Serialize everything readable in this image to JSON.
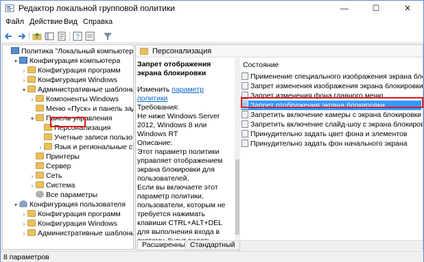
{
  "window": {
    "title": "Редактор локальной групповой политики",
    "accent": "#5a8ccc"
  },
  "menu": [
    "Файл",
    "Действие",
    "Вид",
    "Справка"
  ],
  "toolbar": {
    "icons": [
      "back-icon",
      "forward-icon",
      "up-folder-icon",
      "show-hide-tree-icon",
      "export-list-icon",
      "help-icon",
      "properties-icon",
      "filter-icon"
    ]
  },
  "tree": [
    {
      "label": "Политика \"Локальный компьютер\"",
      "depth": 0,
      "expand": "",
      "icon": "computer"
    },
    {
      "label": "Конфигурация компьютера",
      "depth": 1,
      "expand": "▾",
      "icon": "computer"
    },
    {
      "label": "Конфигурация программ",
      "depth": 2,
      "expand": "›",
      "icon": "folder"
    },
    {
      "label": "Конфигурация Windows",
      "depth": 2,
      "expand": "›",
      "icon": "folder"
    },
    {
      "label": "Административные шаблоны",
      "depth": 2,
      "expand": "▾",
      "icon": "folder"
    },
    {
      "label": "Компоненты Windows",
      "depth": 3,
      "expand": "›",
      "icon": "folder"
    },
    {
      "label": "Меню «Пуск» и панель задач",
      "depth": 3,
      "expand": "",
      "icon": "folder"
    },
    {
      "label": "Панель управления",
      "depth": 3,
      "expand": "▾",
      "icon": "folder"
    },
    {
      "label": "Персонализация",
      "depth": 4,
      "expand": "",
      "icon": "folder",
      "selected": true
    },
    {
      "label": "Учетные записи пользоват",
      "depth": 4,
      "expand": "",
      "icon": "folder"
    },
    {
      "label": "Язык и региональные стан",
      "depth": 4,
      "expand": "›",
      "icon": "folder"
    },
    {
      "label": "Принтеры",
      "depth": 3,
      "expand": "",
      "icon": "folder"
    },
    {
      "label": "Сервер",
      "depth": 3,
      "expand": "",
      "icon": "folder"
    },
    {
      "label": "Сеть",
      "depth": 3,
      "expand": "›",
      "icon": "folder"
    },
    {
      "label": "Система",
      "depth": 3,
      "expand": "›",
      "icon": "folder"
    },
    {
      "label": "Все параметры",
      "depth": 3,
      "expand": "",
      "icon": "gear"
    },
    {
      "label": "Конфигурация пользователя",
      "depth": 1,
      "expand": "▾",
      "icon": "user"
    },
    {
      "label": "Конфигурация программ",
      "depth": 2,
      "expand": "›",
      "icon": "folder"
    },
    {
      "label": "Конфигурация Windows",
      "depth": 2,
      "expand": "›",
      "icon": "folder"
    },
    {
      "label": "Административные шаблоны",
      "depth": 2,
      "expand": "›",
      "icon": "folder"
    }
  ],
  "pane": {
    "header": "Персонализация",
    "desc_title": "Запрет отображения экрана блокировки",
    "edit_prefix": "Изменить",
    "edit_link": "параметр политики",
    "req_label": "Требования:",
    "req_text": "Не ниже Windows Server 2012, Windows 8 или Windows RT",
    "desc_label": "Описание:",
    "desc_text": "Этот параметр политики управляет отображением экрана блокировки для пользователей.",
    "desc_more": "Если вы включаете этот параметр политики, пользователи, которым не требуется нажимать клавиши CTRL+ALT+DEL для выполнения входа в систему, будут видеть выбранную ими плитку после блокировки своего компьютера."
  },
  "list": {
    "column": "Состояние",
    "items": [
      "Применение специального изображения экрана блокиро",
      "Запрет изменения изображения экрана блокировки",
      "Запрет изменения фона главного меню",
      "Запрет отображения экрана блокировки",
      "Запретить включение камеры с экрана блокировки",
      "Запретить включение слайд-шоу с экрана блокировки",
      "Принудительно задать цвет фона и элементов",
      "Принудительно задать фон начального экрана"
    ],
    "selected_index": 3
  },
  "tabs": [
    "Расширенный",
    "Стандартный"
  ],
  "status": "8 параметров"
}
